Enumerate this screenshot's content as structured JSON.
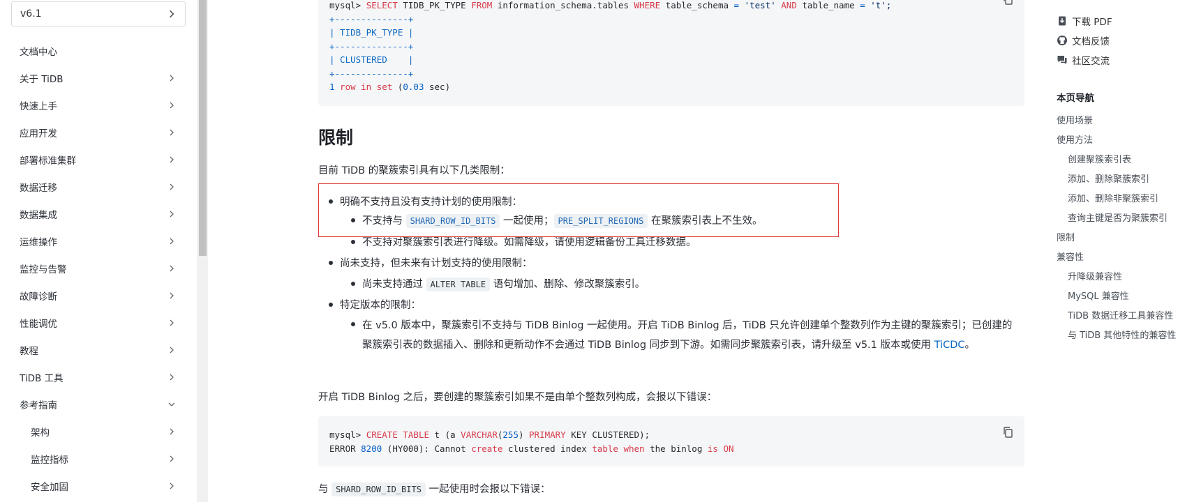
{
  "sidebar": {
    "version": "v6.1",
    "items": [
      {
        "label": "文档中心",
        "chevron": "none"
      },
      {
        "label": "关于 TiDB",
        "chevron": "right"
      },
      {
        "label": "快速上手",
        "chevron": "right"
      },
      {
        "label": "应用开发",
        "chevron": "right"
      },
      {
        "label": "部署标准集群",
        "chevron": "right"
      },
      {
        "label": "数据迁移",
        "chevron": "right"
      },
      {
        "label": "数据集成",
        "chevron": "right"
      },
      {
        "label": "运维操作",
        "chevron": "right"
      },
      {
        "label": "监控与告警",
        "chevron": "right"
      },
      {
        "label": "故障诊断",
        "chevron": "right"
      },
      {
        "label": "性能调优",
        "chevron": "right"
      },
      {
        "label": "教程",
        "chevron": "right"
      },
      {
        "label": "TiDB 工具",
        "chevron": "right"
      },
      {
        "label": "参考指南",
        "chevron": "down"
      },
      {
        "label": "架构",
        "chevron": "right",
        "sub": true
      },
      {
        "label": "监控指标",
        "chevron": "right",
        "sub": true
      },
      {
        "label": "安全加固",
        "chevron": "right",
        "sub": true
      }
    ]
  },
  "code1": {
    "prompt": "mysql> ",
    "select": "SELECT",
    "col": " TIDB_PK_TYPE ",
    "from": "FROM",
    "tbl": " information_schema.tables ",
    "where": "WHERE",
    "cond1": " table_schema ",
    "eq1": "=",
    "val1": " 'test' ",
    "and": "AND",
    "cond2": " table_name ",
    "eq2": "=",
    "val2": " 't';",
    "border": "+--------------+",
    "header": "| TIDB_PK_TYPE |",
    "row": "| CLUSTERED    |",
    "rowcount_num": "1",
    "rowcount_kw": " row in set ",
    "rowcount_paren_open": "(",
    "rowcount_time": "0.03",
    "rowcount_paren_close": " sec)"
  },
  "section": {
    "title": "限制",
    "intro": "目前 TiDB 的聚簇索引具有以下几类限制："
  },
  "list": {
    "a_label": "明确不支持且没有支持计划的使用限制：",
    "a1_pre": "不支持与 ",
    "a1_code1": "SHARD_ROW_ID_BITS",
    "a1_mid": " 一起使用；",
    "a1_code2": "PRE_SPLIT_REGIONS",
    "a1_post": " 在聚簇索引表上不生效。",
    "a2": "不支持对聚簇索引表进行降级。如需降级，请使用逻辑备份工具迁移数据。",
    "b_label": "尚未支持，但未来有计划支持的使用限制：",
    "b1_pre": "尚未支持通过 ",
    "b1_code": "ALTER TABLE",
    "b1_post": " 语句增加、删除、修改聚簇索引。",
    "c_label": "特定版本的限制：",
    "c1_text": "在 v5.0 版本中，聚簇索引不支持与 TiDB Binlog 一起使用。开启 TiDB Binlog 后，TiDB 只允许创建单个整数列作为主键的聚簇索引；已创建的聚簇索引表的数据插入、删除和更新动作不会通过 TiDB Binlog 同步到下游。如需同步聚簇索引表，请升级至 v5.1 版本或使用 ",
    "c1_link": "TiCDC",
    "c1_end": "。"
  },
  "binlog_para": "开启 TiDB Binlog 之后，要创建的聚簇索引如果不是由单个整数列构成，会报以下错误：",
  "code2": {
    "prompt": "mysql> ",
    "create": "CREATE",
    "sp1": " ",
    "table": "TABLE",
    "t": " t (a ",
    "varchar": "VARCHAR",
    "paren": "(",
    "num": "255",
    "paren2": ") ",
    "primary": "PRIMARY",
    "rest": " KEY CLUSTERED);",
    "err1": "ERROR ",
    "errnum": "8200",
    "err2": " (HY000): Cannot ",
    "err_create": "create",
    "err3": " clustered index ",
    "err_table": "table",
    "err_sp": " ",
    "err_when": "when",
    "err4": " the binlog ",
    "err_is": "is",
    "err_sp2": " ",
    "err_on": "ON"
  },
  "shard_para": {
    "pre": "与 ",
    "code": "SHARD_ROW_ID_BITS",
    "post": " 一起使用时会报以下错误："
  },
  "right": {
    "actions": [
      {
        "label": "下载 PDF",
        "icon": "download-icon"
      },
      {
        "label": "文档反馈",
        "icon": "github-icon"
      },
      {
        "label": "社区交流",
        "icon": "chat-icon"
      }
    ],
    "toc_title": "本页导航",
    "toc": [
      {
        "label": "使用场景",
        "sub": false
      },
      {
        "label": "使用方法",
        "sub": false
      },
      {
        "label": "创建聚簇索引表",
        "sub": true
      },
      {
        "label": "添加、删除聚簇索引",
        "sub": true
      },
      {
        "label": "添加、删除非聚簇索引",
        "sub": true
      },
      {
        "label": "查询主键是否为聚簇索引",
        "sub": true
      },
      {
        "label": "限制",
        "sub": false
      },
      {
        "label": "兼容性",
        "sub": false
      },
      {
        "label": "升降级兼容性",
        "sub": true
      },
      {
        "label": "MySQL 兼容性",
        "sub": true
      },
      {
        "label": "TiDB 数据迁移工具兼容性",
        "sub": true
      },
      {
        "label": "与 TiDB 其他特性的兼容性",
        "sub": true
      }
    ]
  }
}
